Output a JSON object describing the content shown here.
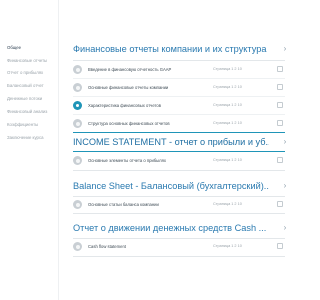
{
  "sidebar": {
    "items": [
      {
        "label": "Общее",
        "active": true
      },
      {
        "label": "Финансовые отчеты",
        "active": false
      },
      {
        "label": "Отчет о прибылях",
        "active": false
      },
      {
        "label": "Балансовый отчет",
        "active": false
      },
      {
        "label": "Денежные потоки",
        "active": false
      },
      {
        "label": "Финансовый анализ",
        "active": false
      },
      {
        "label": "Коэффициенты",
        "active": false
      },
      {
        "label": "Заключение курса",
        "active": false
      }
    ]
  },
  "sections": [
    {
      "title": "Финансовые отчеты компании и их структура",
      "accent": false,
      "items": [
        {
          "title": "Введение в финансовую отчетность GAAP",
          "meta": "Страница 1 2 10",
          "done": false
        },
        {
          "title": "Основные финансовые отчеты компании",
          "meta": "Страница 1 2 10",
          "done": false
        },
        {
          "title": "Характеристика финансовых отчетов",
          "meta": "Страница 1 2 10",
          "done": true
        },
        {
          "title": "Структура основных финансовых отчетов",
          "meta": "Страница 1 2 10",
          "done": false
        }
      ]
    },
    {
      "title": "INCOME STATEMENT - отчет о прибыли и уб...",
      "accent": true,
      "items": [
        {
          "title": "Основные элементы отчета о прибылях",
          "meta": "Страница 1 2 10",
          "done": false
        }
      ]
    },
    {
      "title": "Balance Sheet - Балансовый (бухгалтерский)...",
      "accent": false,
      "items": [
        {
          "title": "Основные статьи баланса компании",
          "meta": "Страница 1 2 10",
          "done": false
        }
      ]
    },
    {
      "title": "Отчет о движении денежных средств Cash ...",
      "accent": false,
      "items": [
        {
          "title": "Cash flow statement",
          "meta": "Страница 1 2 10",
          "done": false
        }
      ]
    }
  ],
  "icons": {
    "chevron": "chevron-right-icon",
    "item": "page-icon",
    "done": "check-circle-icon"
  },
  "colors": {
    "accent": "#1f95b8",
    "title": "#2a7ab0"
  }
}
